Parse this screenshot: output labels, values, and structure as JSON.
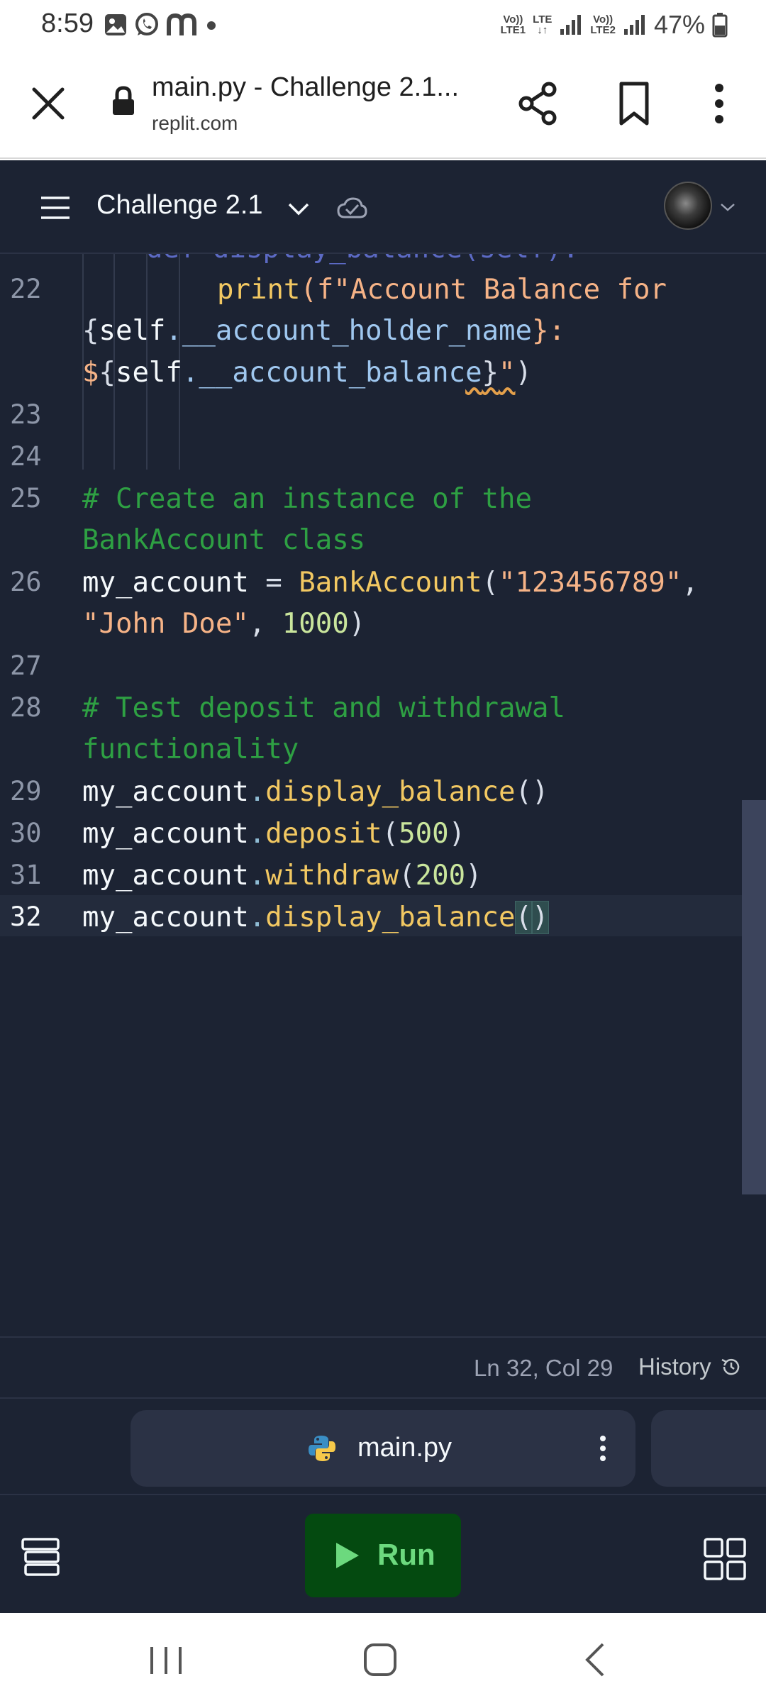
{
  "status_bar": {
    "time": "8:59",
    "notification_icons": [
      "gallery-icon",
      "whatsapp-icon",
      "messenger-icon"
    ],
    "sim1_label_top": "Vo))",
    "sim1_label_bottom": "LTE1",
    "lte_label": "LTE",
    "sim2_label_top": "Vo))",
    "sim2_label_bottom": "LTE2",
    "battery_percent": "47%"
  },
  "browser": {
    "page_title": "main.py - Challenge 2.1...",
    "domain": "replit.com"
  },
  "replit": {
    "repl_name": "Challenge 2.1",
    "accent_color": "#1c2333"
  },
  "editor": {
    "line_numbers": [
      "22",
      "23",
      "24",
      "25",
      "26",
      "27",
      "28",
      "29",
      "30",
      "31",
      "32"
    ],
    "active_line": "32",
    "cut_off_text": "def display_balance(self):",
    "tokens": {
      "print_fn": "print",
      "fstring_open": "(f\"Account Balance for",
      "brace_open": "{",
      "self1": "self",
      "attr1": ".__account_holder_name",
      "brace_close_colon": "}:",
      "dollar": "$",
      "brace_open2": "{",
      "self2": "self",
      "attr2": ".__account_balanc",
      "attr2_tail": "e",
      "brace_close2": "}",
      "quote_close": "\"",
      "paren_close": ")",
      "comment25a": "# Create an instance of the",
      "comment25b": "BankAccount class",
      "var26": "my_account",
      "eq26": " = ",
      "cls26": "BankAccount",
      "paren26": "(",
      "str26a": "\"123456789\"",
      "comma26": ",",
      "str26b": "\"John Doe\"",
      "comma26b": ", ",
      "num26": "1000",
      "paren26c": ")",
      "comment28a": "# Test deposit and withdrawal",
      "comment28b": "functionality",
      "var29": "my_account",
      "dot29": ".",
      "fn29": "display_balance",
      "args29": "()",
      "var30": "my_account",
      "dot30": ".",
      "fn30": "deposit",
      "open30": "(",
      "num30": "500",
      "close30": ")",
      "var31": "my_account",
      "dot31": ".",
      "fn31": "withdraw",
      "open31": "(",
      "num31": "200",
      "close31": ")",
      "var32": "my_account",
      "dot32": ".",
      "fn32": "display_balance",
      "open32": "(",
      "close32": ")"
    }
  },
  "status_line": {
    "cursor_position": "Ln 32, Col 29",
    "history_label": "History"
  },
  "file_tabs": [
    {
      "label": "main.py",
      "icon": "python-icon"
    }
  ],
  "toolbar": {
    "run_label": "Run"
  },
  "nav_bar": {
    "buttons": [
      "recents",
      "home",
      "back"
    ]
  }
}
